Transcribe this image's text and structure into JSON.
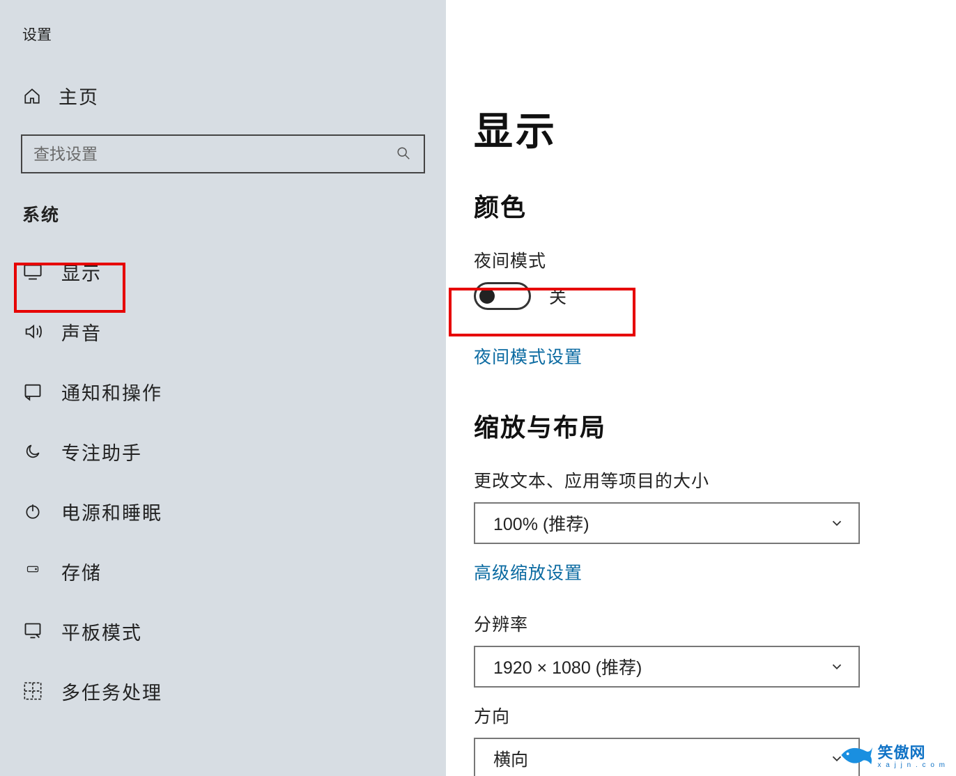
{
  "window": {
    "title": "设置"
  },
  "sidebar": {
    "home_label": "主页",
    "search_placeholder": "查找设置",
    "section_title": "系统",
    "items": [
      {
        "label": "显示",
        "icon": "monitor-icon"
      },
      {
        "label": "声音",
        "icon": "sound-icon"
      },
      {
        "label": "通知和操作",
        "icon": "notification-icon"
      },
      {
        "label": "专注助手",
        "icon": "moon-icon"
      },
      {
        "label": "电源和睡眠",
        "icon": "power-icon"
      },
      {
        "label": "存储",
        "icon": "storage-icon"
      },
      {
        "label": "平板模式",
        "icon": "tablet-icon"
      },
      {
        "label": "多任务处理",
        "icon": "multitask-icon"
      }
    ]
  },
  "main": {
    "page_title": "显示",
    "color_section": "颜色",
    "night_mode_label": "夜间模式",
    "night_mode_state": "关",
    "night_mode_link": "夜间模式设置",
    "scale_section": "缩放与布局",
    "scale_label": "更改文本、应用等项目的大小",
    "scale_value": "100% (推荐)",
    "adv_scale_link": "高级缩放设置",
    "resolution_label": "分辨率",
    "resolution_value": "1920 × 1080 (推荐)",
    "orientation_label": "方向",
    "orientation_value": "横向"
  },
  "watermark": {
    "text": "笑傲网",
    "sub": "x a j j n . c o m"
  },
  "colors": {
    "accent_link": "#0a6aa1",
    "highlight": "#e60000",
    "topbar": "#0050a5"
  }
}
